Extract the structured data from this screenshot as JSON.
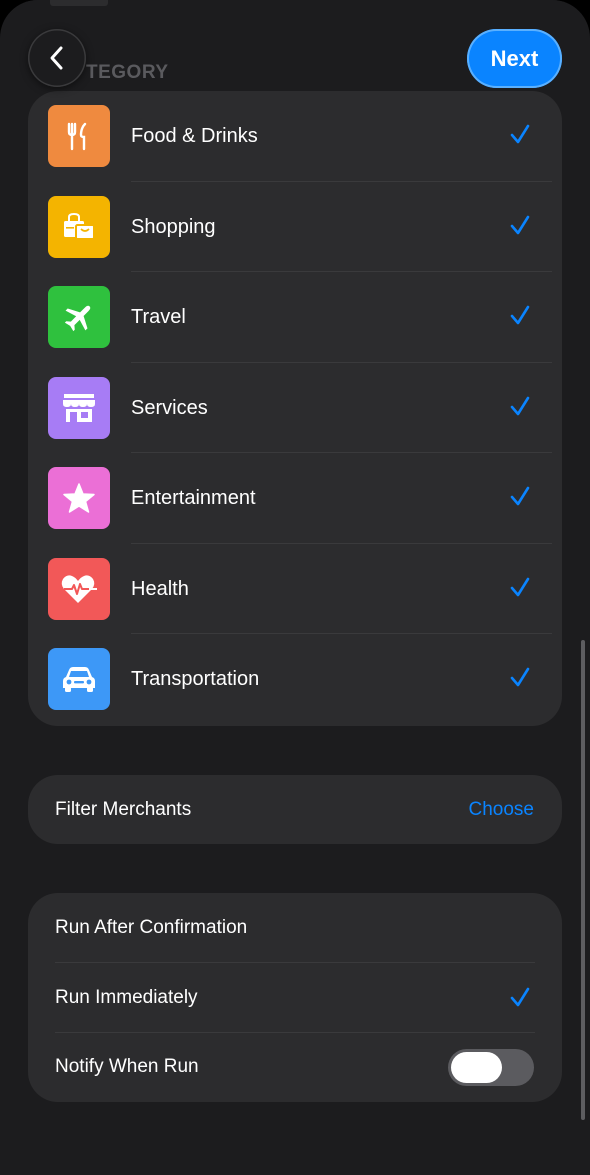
{
  "header": {
    "section_title": "TEGORY",
    "back_icon": "chevron-left-icon",
    "next_label": "Next"
  },
  "colors": {
    "accent": "#0a84ff",
    "background": "#1c1c1e",
    "card": "#2c2c2e"
  },
  "categories": [
    {
      "label": "Food & Drinks",
      "icon": "fork-knife-icon",
      "color": "#ef8a3f",
      "selected": true
    },
    {
      "label": "Shopping",
      "icon": "shopping-bags-icon",
      "color": "#f4b400",
      "selected": true
    },
    {
      "label": "Travel",
      "icon": "airplane-icon",
      "color": "#2fc13e",
      "selected": true
    },
    {
      "label": "Services",
      "icon": "storefront-icon",
      "color": "#a77cf5",
      "selected": true
    },
    {
      "label": "Entertainment",
      "icon": "star-icon",
      "color": "#eb6fd6",
      "selected": true
    },
    {
      "label": "Health",
      "icon": "heart-pulse-icon",
      "color": "#f25858",
      "selected": true
    },
    {
      "label": "Transportation",
      "icon": "car-icon",
      "color": "#3d98f7",
      "selected": true
    }
  ],
  "merchants": {
    "label": "Filter Merchants",
    "action": "Choose"
  },
  "run_options": {
    "after_confirmation": "Run After Confirmation",
    "immediately": "Run Immediately",
    "immediately_selected": true,
    "notify": "Notify When Run",
    "notify_enabled": false
  }
}
